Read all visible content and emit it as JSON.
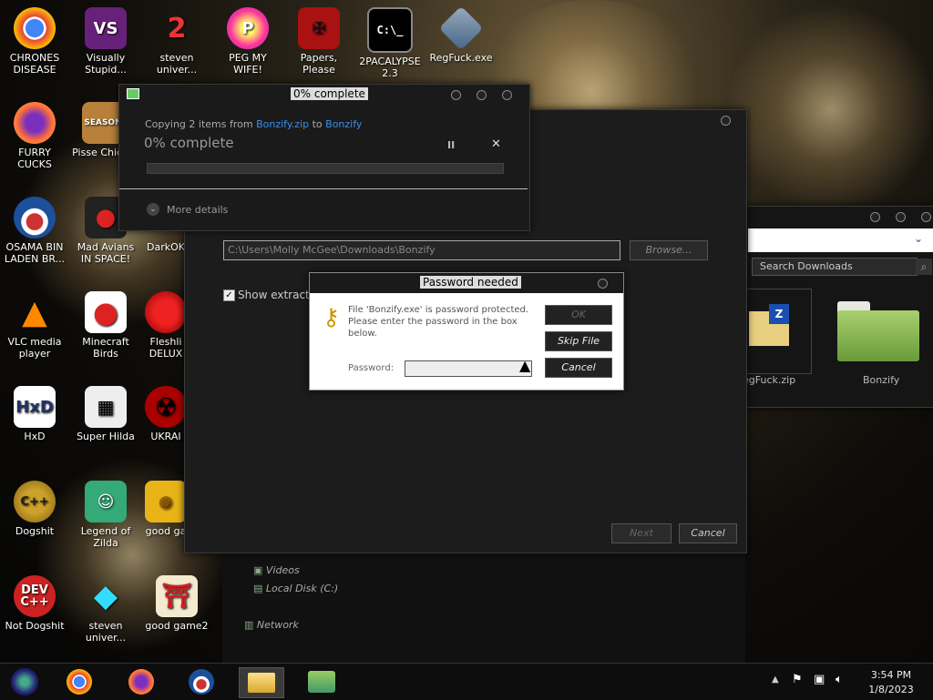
{
  "desktop": {
    "icons": [
      {
        "label": "CHRONES DISEASE",
        "icon": "chrome-icon"
      },
      {
        "label": "Visually Stupid...",
        "icon": "visual-studio-icon"
      },
      {
        "label": "steven univer...",
        "icon": "steven-universe-icon"
      },
      {
        "label": "PEG MY WIFE!",
        "icon": "peggle-icon"
      },
      {
        "label": "Papers, Please",
        "icon": "papers-please-icon"
      },
      {
        "label": "2PACALYPSE 2.3",
        "icon": "terminal-icon"
      },
      {
        "label": "RegFuck.exe",
        "icon": "regedit-icon"
      },
      {
        "label": "FURRY CUCKS",
        "icon": "firefox-icon"
      },
      {
        "label": "Pisse Chicke",
        "icon": "season-icon"
      },
      {
        "label": "OSAMA BIN LADEN BR...",
        "icon": "obama-icon"
      },
      {
        "label": "Mad Avians IN SPACE!",
        "icon": "angry-birds-space-icon"
      },
      {
        "label": "DarkOK",
        "icon": "darkok-icon"
      },
      {
        "label": "VLC media player",
        "icon": "vlc-icon"
      },
      {
        "label": "Minecraft Birds",
        "icon": "angry-birds-icon"
      },
      {
        "label": "Fleshli DELUX",
        "icon": "fleshli-icon"
      },
      {
        "label": "HxD",
        "icon": "hxd-icon"
      },
      {
        "label": "Super Hilda",
        "icon": "super-hilda-icon"
      },
      {
        "label": "UKRAI",
        "icon": "radiation-icon"
      },
      {
        "label": "Dogshit",
        "icon": "cpp-icon"
      },
      {
        "label": "Legend of Zilda",
        "icon": "zelda-icon"
      },
      {
        "label": "good ga",
        "icon": "good-game-icon"
      },
      {
        "label": "Not Dogshit",
        "icon": "devcpp-icon"
      },
      {
        "label": "steven univer...",
        "icon": "gem-icon"
      },
      {
        "label": "good game2",
        "icon": "torii-icon"
      }
    ]
  },
  "progress_dialog": {
    "title": "0% complete",
    "copy_prefix": "Copying 2 items from",
    "copy_source": "Bonzify.zip",
    "copy_to": "to",
    "copy_dest": "Bonzify",
    "status": "0% complete",
    "progress": 0,
    "pause_glyph": "II",
    "cancel_glyph": "✕",
    "more_details": "More details"
  },
  "extract_dialog": {
    "path_value": "C:\\Users\\Molly McGee\\Downloads\\Bonzify",
    "browse_label": "Browse...",
    "show_extracted_label": "Show extracte",
    "next_label": "Next",
    "cancel_label": "Cancel"
  },
  "password_dialog": {
    "title": "Password needed",
    "message_line1": "File 'Bonzify.exe' is password protected.",
    "message_line2": "Please enter the password in the box",
    "message_line3": "below.",
    "password_label": "Password:",
    "ok_label": "OK",
    "skip_label": "Skip File",
    "cancel_label": "Cancel"
  },
  "explorer": {
    "search_placeholder": "Search Downloads",
    "nav_items": [
      "Videos",
      "Local Disk (C:)",
      "Network"
    ],
    "files": [
      {
        "name": "RegFuck.zip",
        "label": "egFuck.zip"
      },
      {
        "name": "Bonzify",
        "label": "Bonzify"
      }
    ]
  },
  "taskbar": {
    "time": "3:54 PM",
    "date": "1/8/2023",
    "apps": [
      "start-icon",
      "chrome-icon",
      "firefox-icon",
      "obama-icon",
      "file-explorer-icon",
      "network-app-icon"
    ]
  },
  "colors": {
    "link": "#3a8eea",
    "accent": "#f2c030"
  }
}
